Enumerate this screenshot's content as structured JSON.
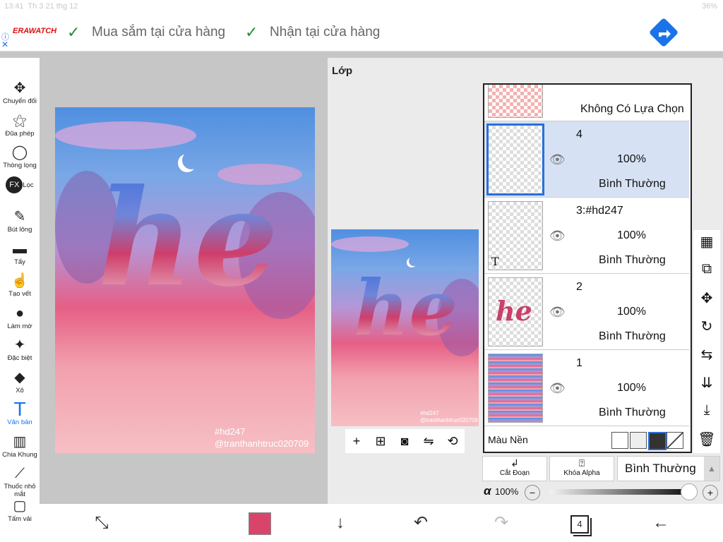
{
  "status": {
    "time": "13:41",
    "date": "Th 3 21 thg 12",
    "battery": "36%"
  },
  "ad": {
    "brand": "ERAWATCH",
    "item1": "Mua sắm tại cửa hàng",
    "item2": "Nhận tại cửa hàng",
    "info": "ⓘ",
    "close": "✕"
  },
  "tools": [
    {
      "label": "Chuyển đổi",
      "icon": "move-icon"
    },
    {
      "label": "Đũa phép",
      "icon": "magic-wand-icon"
    },
    {
      "label": "Thòng lọng",
      "icon": "lasso-icon"
    },
    {
      "label": "Lọc",
      "icon": "fx-icon",
      "glyph": "FX"
    },
    {
      "label": "Bút lông",
      "icon": "brush-icon"
    },
    {
      "label": "Tẩy",
      "icon": "eraser-icon"
    },
    {
      "label": "Tạo vết",
      "icon": "smudge-icon"
    },
    {
      "label": "Làm mờ",
      "icon": "blur-icon"
    },
    {
      "label": "Đặc biệt",
      "icon": "special-icon"
    },
    {
      "label": "Xô",
      "icon": "bucket-icon"
    },
    {
      "label": "Văn bản",
      "icon": "text-icon",
      "glyph": "T",
      "active": true
    },
    {
      "label": "Chia Khung",
      "icon": "frame-divider-icon"
    },
    {
      "label": "Thuốc nhỏ mắt",
      "icon": "eyedropper-icon"
    },
    {
      "label": "Tấm vải",
      "icon": "canvas-icon"
    }
  ],
  "artwork": {
    "text": "he",
    "tag": "#hd247",
    "credit": "@tranthanhtruc020709"
  },
  "panel": {
    "title": "Lớp"
  },
  "selection_layer": {
    "label": "Không Có Lựa Chọn"
  },
  "layers": [
    {
      "name": "4",
      "opacity": "100%",
      "mode": "Bình Thường",
      "selected": true
    },
    {
      "name": "3:#hd247",
      "opacity": "100%",
      "mode": "Bình Thường",
      "thumb_text": "T"
    },
    {
      "name": "2",
      "opacity": "100%",
      "mode": "Bình Thường",
      "thumb_text": "he"
    },
    {
      "name": "1",
      "opacity": "100%",
      "mode": "Bình Thường"
    }
  ],
  "background": {
    "label": "Màu Nền"
  },
  "blend": {
    "clip_label": "Cắt Đoạn",
    "alpha_lock_label": "Khóa Alpha",
    "mode": "Bình Thường"
  },
  "opacity": {
    "symbol": "α",
    "value": "100%",
    "minus": "−",
    "plus": "+",
    "level": 1.0
  },
  "bottom": {
    "layer_count": "4",
    "color": "#d9456a"
  },
  "colors": {
    "accent": "#1a73e8",
    "selected_layer": "#d6e2f4",
    "primary_color": "#d9456a"
  }
}
